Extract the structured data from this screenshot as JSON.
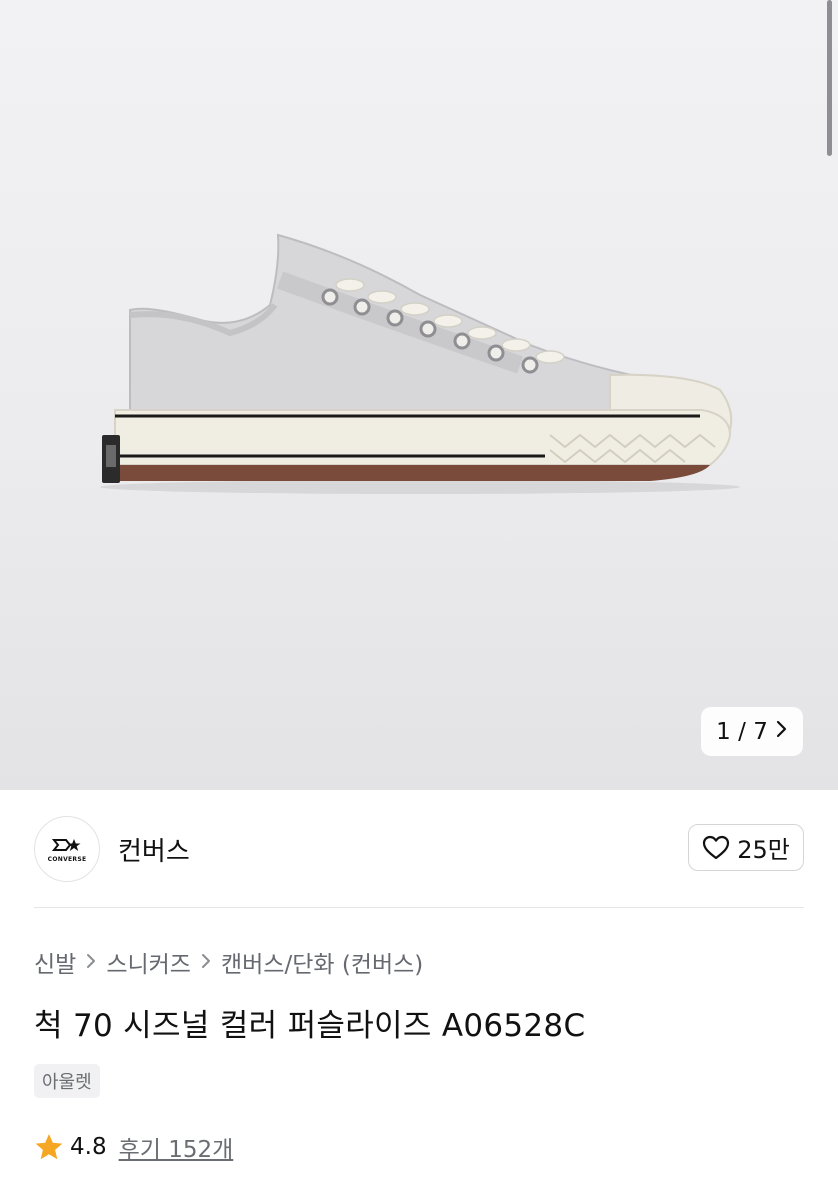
{
  "gallery": {
    "current": "1",
    "separator": "/",
    "total": "7",
    "next_icon": "chevron-right-icon"
  },
  "brand": {
    "logo_wordmark": "CONVERSE",
    "name": "컨버스",
    "like_icon": "heart-outline-icon",
    "like_count": "25만"
  },
  "breadcrumb": {
    "items": [
      "신발",
      "스니커즈",
      "캔버스/단화 (컨버스)"
    ],
    "separator_icon": "chevron-right-icon"
  },
  "product": {
    "title": "척 70 시즈널 컬러 퍼슬라이즈 A06528C",
    "tag": "아울렛",
    "rating": "4.8",
    "reviews_label": "후기 152개",
    "star_color": "#f5a623"
  }
}
